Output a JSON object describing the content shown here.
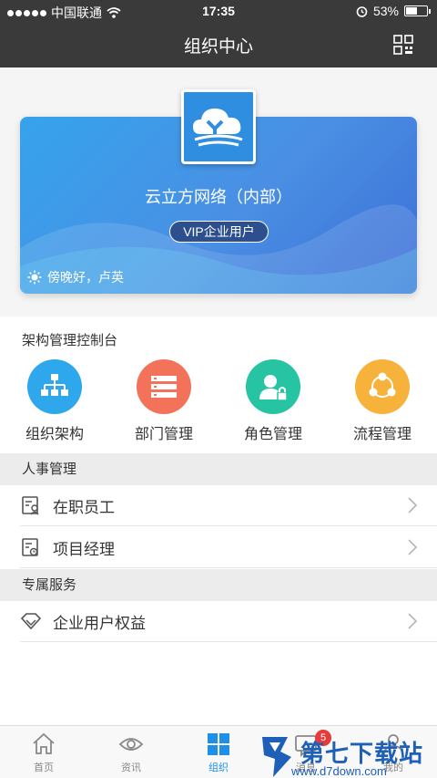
{
  "status_bar": {
    "carrier": "中国联通",
    "time": "17:35",
    "battery": "53%",
    "battery_fraction": 0.53
  },
  "header": {
    "title": "组织中心",
    "qr_icon": "qr-code-icon"
  },
  "org_card": {
    "company": "云立方网络（内部）",
    "badge": "VIP企业用户",
    "greeting": "傍晚好，卢英"
  },
  "console": {
    "title": "架构管理控制台",
    "items": [
      {
        "label": "组织架构",
        "icon": "org-chart-icon",
        "color": "#2ea7ec"
      },
      {
        "label": "部门管理",
        "icon": "list-icon",
        "color": "#f3725a"
      },
      {
        "label": "角色管理",
        "icon": "user-lock-icon",
        "color": "#26c4a2"
      },
      {
        "label": "流程管理",
        "icon": "flow-icon",
        "color": "#f7b23b"
      }
    ]
  },
  "hr": {
    "title": "人事管理",
    "items": [
      {
        "label": "在职员工",
        "icon": "employee-card-icon"
      },
      {
        "label": "项目经理",
        "icon": "manager-card-icon"
      }
    ]
  },
  "exclusive": {
    "title": "专属服务",
    "items": [
      {
        "label": "企业用户权益",
        "icon": "diamond-icon"
      }
    ]
  },
  "tabs": [
    {
      "label": "首页",
      "icon": "home-icon"
    },
    {
      "label": "资讯",
      "icon": "eye-icon"
    },
    {
      "label": "组织",
      "icon": "grid-icon"
    },
    {
      "label": "消息",
      "icon": "message-icon"
    },
    {
      "label": "我的",
      "icon": "user-icon"
    }
  ],
  "message_badge": "5",
  "watermark": {
    "title": "第七下载站",
    "url": "www.d7down.com"
  }
}
